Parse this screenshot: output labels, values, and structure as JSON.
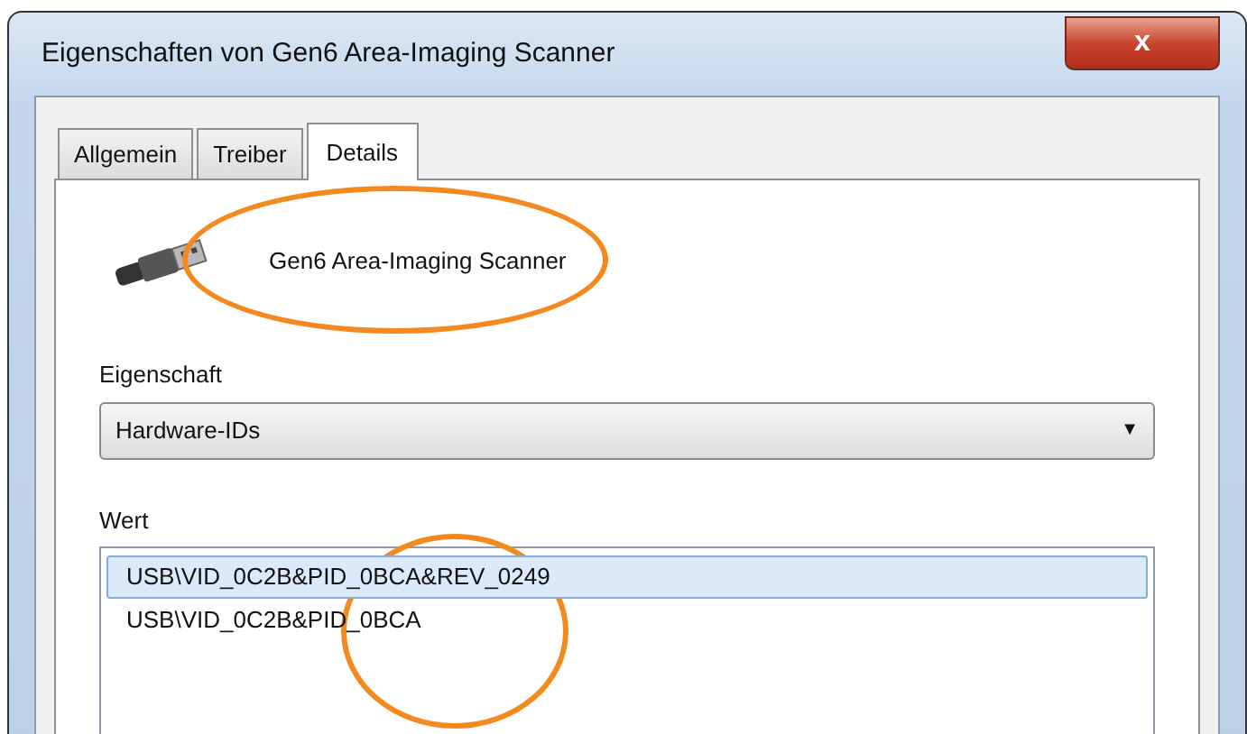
{
  "window": {
    "title": "Eigenschaften von Gen6 Area-Imaging Scanner",
    "close": "x"
  },
  "tabs": [
    {
      "label": "Allgemein",
      "selected": false
    },
    {
      "label": "Treiber",
      "selected": false
    },
    {
      "label": "Details",
      "selected": true
    }
  ],
  "device_name": "Gen6 Area-Imaging Scanner",
  "property": {
    "label": "Eigenschaft",
    "value": "Hardware-IDs",
    "arrow": "▼"
  },
  "values": {
    "label": "Wert",
    "items": [
      {
        "text": "USB\\VID_0C2B&PID_0BCA&REV_0249",
        "selected": true
      },
      {
        "text": "USB\\VID_0C2B&PID_0BCA",
        "selected": false
      }
    ]
  }
}
